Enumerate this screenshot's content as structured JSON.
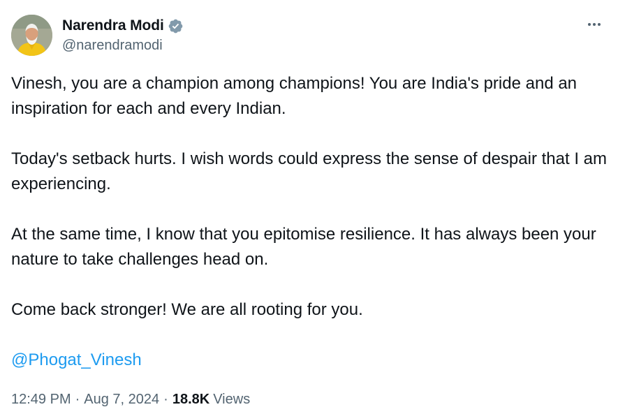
{
  "tweet": {
    "author": {
      "display_name": "Narendra Modi",
      "handle": "@narendramodi",
      "verified_icon": "verified-badge-icon",
      "verified_color": "#829aab"
    },
    "more_icon": "more-horizontal-icon",
    "paragraphs": [
      "Vinesh, you are a champion among champions! You are India's pride and an inspiration for each and every Indian.",
      "Today's setback hurts. I wish words could express the sense of despair that I am experiencing.",
      "At the same time, I know that you epitomise resilience. It has always been your nature to take challenges head on.",
      "Come back stronger! We are all rooting for you."
    ],
    "mention": "@Phogat_Vinesh",
    "mention_color": "#1d9bf0",
    "time": "12:49 PM",
    "date": "Aug 7, 2024",
    "separator": "·",
    "views_count": "18.8K",
    "views_label": "Views"
  }
}
